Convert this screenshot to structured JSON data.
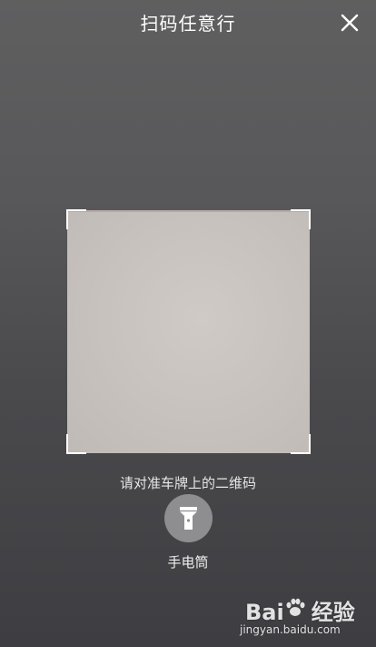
{
  "header": {
    "title": "扫码任意行",
    "close_icon": "close-icon"
  },
  "scanner": {
    "hint": "请对准车牌上的二维码"
  },
  "flashlight": {
    "icon": "flashlight-icon",
    "label": "手电筒"
  },
  "watermark": {
    "brand": "Bai  经验",
    "url": "jingyan.baidu.com"
  },
  "colors": {
    "background": "#555557",
    "scan_area": "#c8c3bf",
    "button_bg": "#8e8e90",
    "text": "#ffffff"
  }
}
